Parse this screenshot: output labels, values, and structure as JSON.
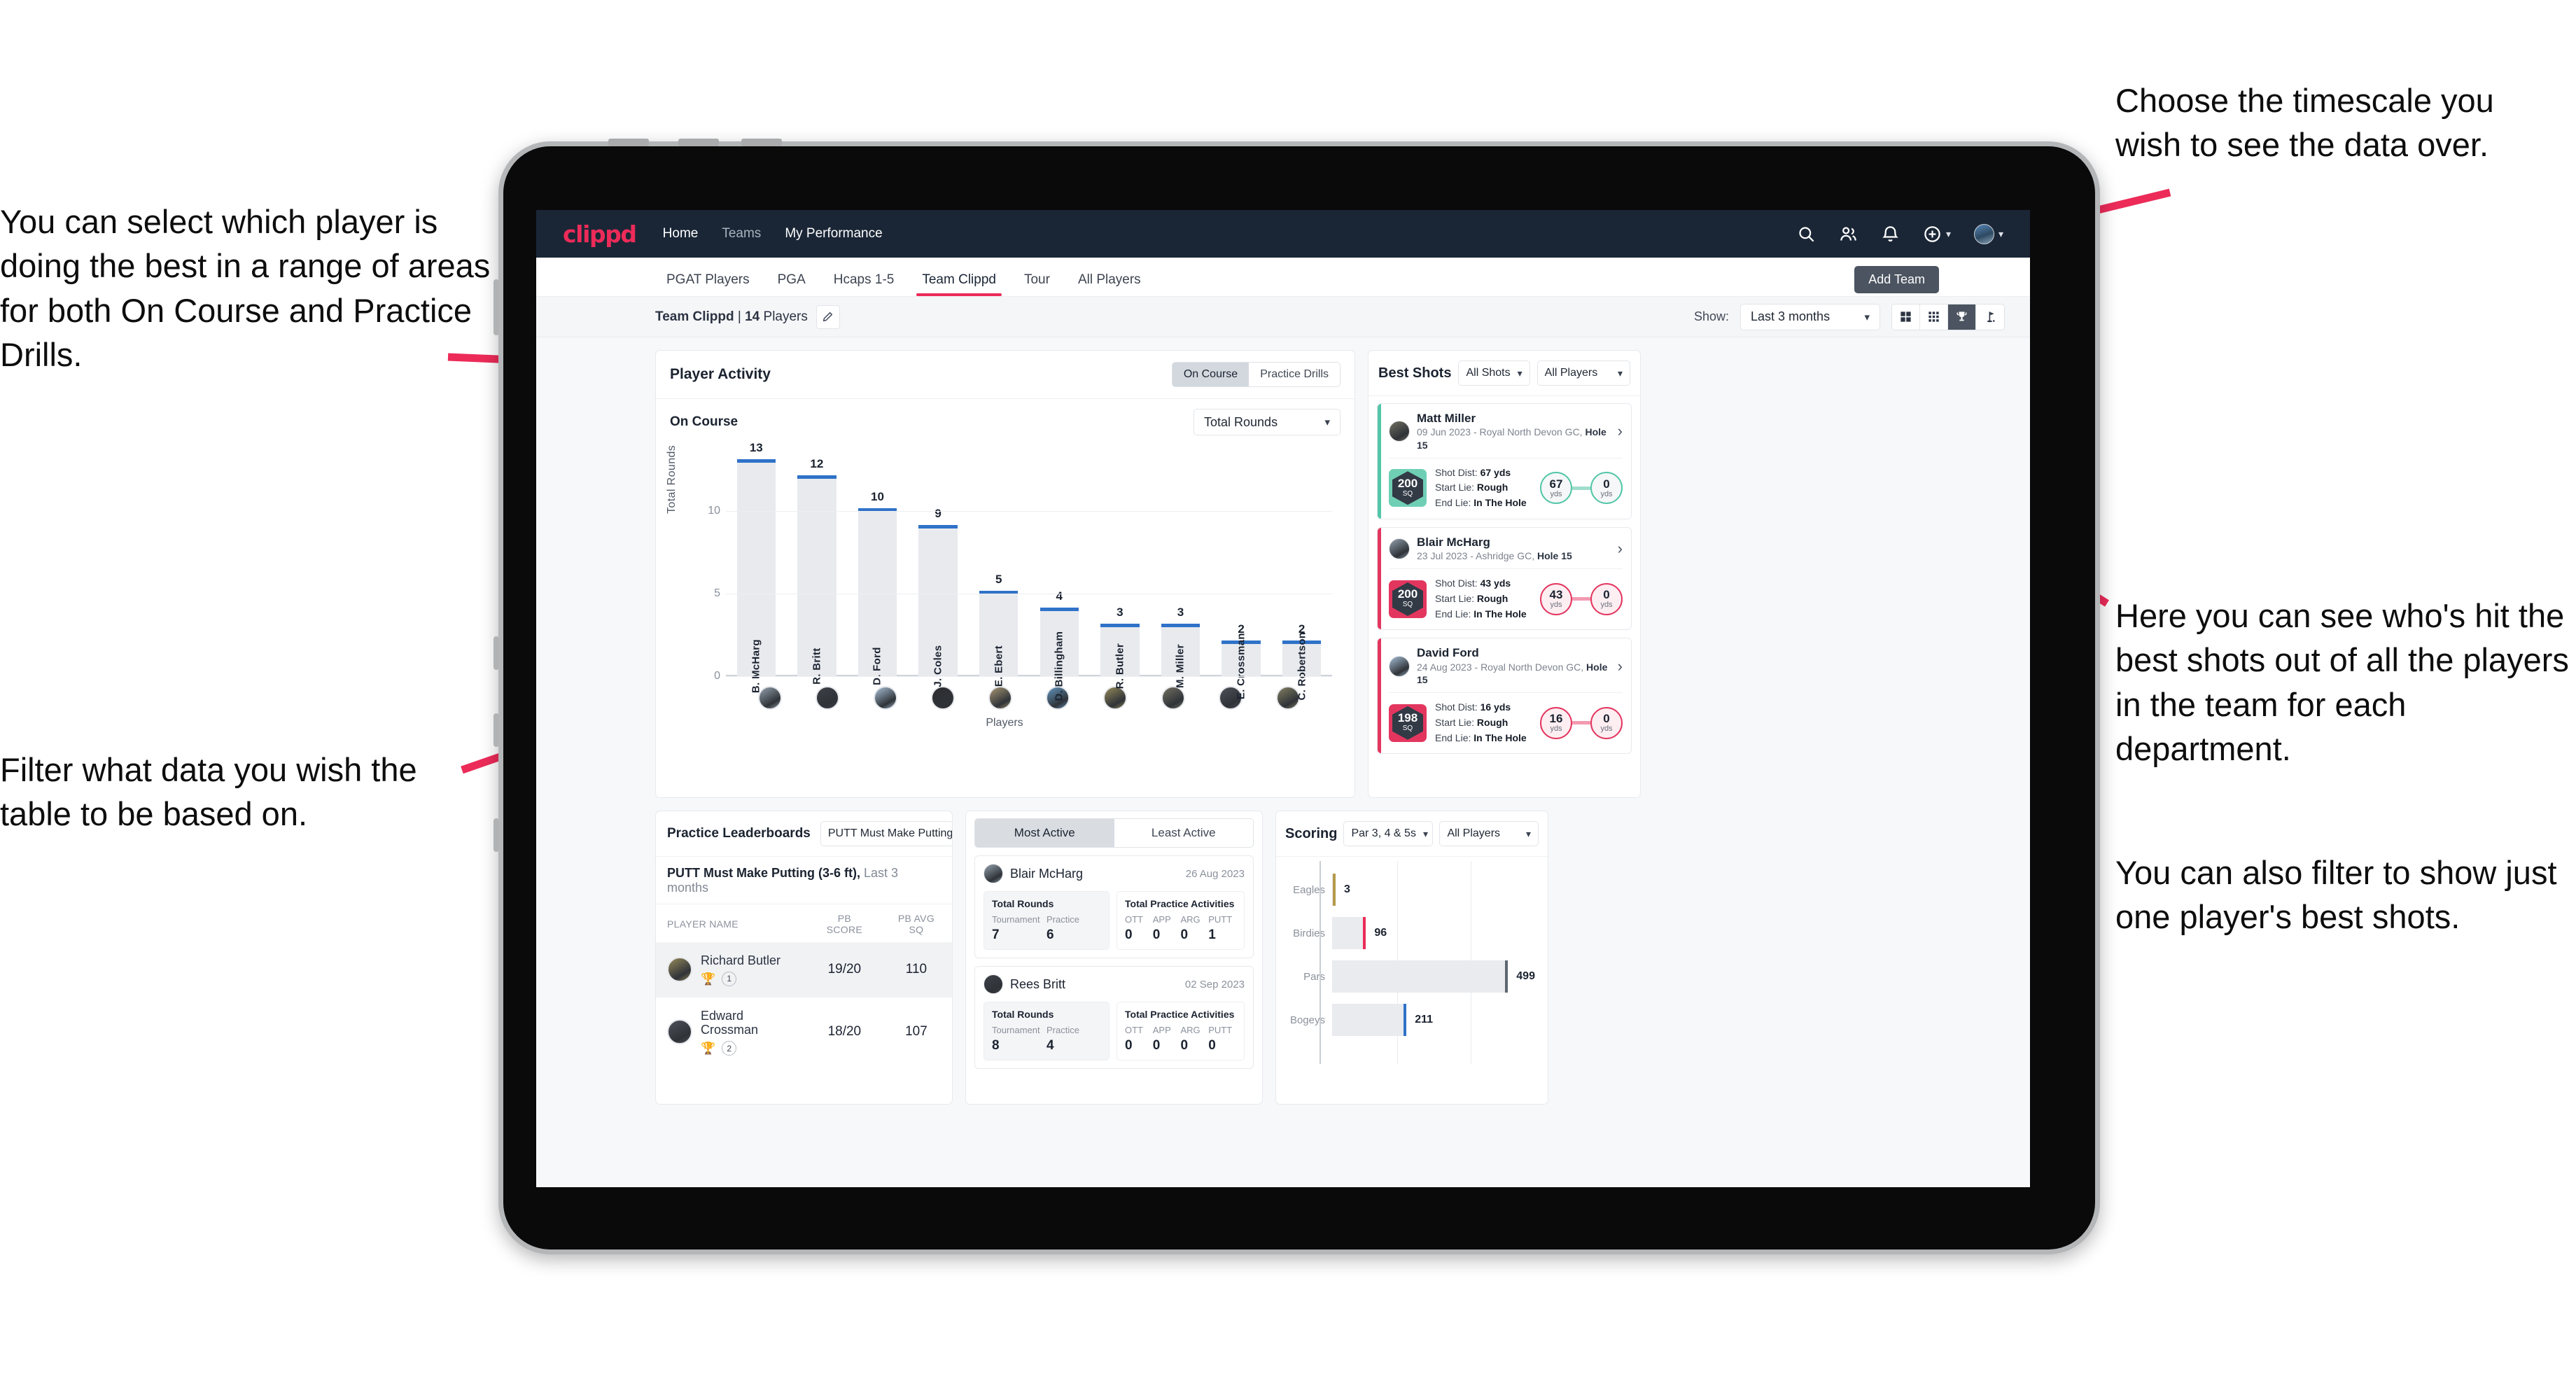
{
  "annotations": {
    "left_top": "You can select which player is doing the best in a range of areas for both On Course and Practice Drills.",
    "left_bottom": "Filter what data you wish the table to be based on.",
    "right_top": "Choose the timescale you wish to see the data over.",
    "right_middle": "Here you can see who's hit the best shots out of all the players in the team for each department.",
    "right_bottom": "You can also filter to show just one player's best shots."
  },
  "app": {
    "brand": "clippd",
    "nav": [
      {
        "label": "Home",
        "active": true
      },
      {
        "label": "Teams",
        "active": false
      },
      {
        "label": "My Performance",
        "active": true
      }
    ],
    "icons": {
      "search": "search-icon",
      "people": "people-icon",
      "bell": "bell-icon",
      "plus": "plus-circle-icon",
      "avatar": "user-avatar"
    },
    "tabs": [
      {
        "label": "PGAT Players",
        "active": false
      },
      {
        "label": "PGA",
        "active": false
      },
      {
        "label": "Hcaps 1-5",
        "active": false
      },
      {
        "label": "Team Clippd",
        "active": true
      },
      {
        "label": "Tour",
        "active": false
      },
      {
        "label": "All Players",
        "active": false
      }
    ],
    "add_team_tooltip": "Add Team",
    "subbar": {
      "team_name": "Team Clippd",
      "team_separator": " | ",
      "player_count": "14",
      "players_word": " Players",
      "edit_icon": "pencil-icon",
      "show_label": "Show:",
      "period_value": "Last 3 months",
      "view_buttons": [
        {
          "name": "grid-large-icon",
          "active": false
        },
        {
          "name": "grid-small-icon",
          "active": false
        },
        {
          "name": "trophy-icon",
          "active": true
        },
        {
          "name": "golf-flag-icon",
          "active": false
        }
      ]
    },
    "accent_color": "#ec2b59",
    "navbar_color": "#1a2636"
  },
  "player_activity": {
    "title": "Player Activity",
    "segments": [
      {
        "label": "On Course",
        "active": true
      },
      {
        "label": "Practice Drills",
        "active": false
      }
    ],
    "sub_label": "On Course",
    "metric_select": "Total Rounds"
  },
  "chart_data": [
    {
      "type": "bar",
      "title": "Player Activity - On Course",
      "xlabel": "Players",
      "ylabel": "Total Rounds",
      "ylim": [
        0,
        14
      ],
      "yticks": [
        0,
        5,
        10
      ],
      "grid": true,
      "categories": [
        "B. McHarg",
        "R. Britt",
        "D. Ford",
        "J. Coles",
        "E. Ebert",
        "D. Billingham",
        "R. Butler",
        "M. Miller",
        "E. Crossman",
        "C. Robertson"
      ],
      "values": [
        13,
        12,
        10,
        9,
        5,
        4,
        3,
        3,
        2,
        2
      ],
      "bar_color": "#e8eaee",
      "cap_color": "#2f72c8",
      "avatar_colors": [
        "#8d9aa6",
        "#3c3f45",
        "#9fb6cc",
        "#2c2c2e",
        "#a09070",
        "#5e8fb6",
        "#8e8357",
        "#6e6c5f",
        "#4b4f56",
        "#7d7a5e"
      ]
    },
    {
      "type": "bar",
      "orientation": "horizontal",
      "title": "Scoring",
      "categories": [
        "Eagles",
        "Birdies",
        "Pars",
        "Bogeys"
      ],
      "values": [
        3,
        96,
        499,
        211
      ],
      "xlim": [
        0,
        560
      ],
      "tip_colors": [
        "#b59a4a",
        "#ec2b59",
        "#5e6672",
        "#2f72c8"
      ],
      "bar_color": "#e9ebee",
      "grid": true
    }
  ],
  "best_shots": {
    "title": "Best Shots",
    "shot_filter": "All Shots",
    "player_filter": "All Players",
    "labels": {
      "shot_dist": "Shot Dist:",
      "start_lie": "Start Lie:",
      "end_lie": "End Lie:",
      "yds": "yds",
      "sq": "SQ"
    },
    "items": [
      {
        "player": "Matt Miller",
        "meta_date": "09 Jun 2023 - Royal North Devon GC, ",
        "meta_hole": "Hole 15",
        "sq_value": "200",
        "shot_dist": "67 yds",
        "start_lie": "Rough",
        "end_lie": "In The Hole",
        "start_value": "67",
        "end_value": "0",
        "accent": "teal",
        "avatar_color": "#6e6c5f"
      },
      {
        "player": "Blair McHarg",
        "meta_date": "23 Jul 2023 - Ashridge GC, ",
        "meta_hole": "Hole 15",
        "sq_value": "200",
        "shot_dist": "43 yds",
        "start_lie": "Rough",
        "end_lie": "In The Hole",
        "start_value": "43",
        "end_value": "0",
        "accent": "pink",
        "avatar_color": "#8d9aa6"
      },
      {
        "player": "David Ford",
        "meta_date": "24 Aug 2023 - Royal North Devon GC, ",
        "meta_hole": "Hole 15",
        "sq_value": "198",
        "shot_dist": "16 yds",
        "start_lie": "Rough",
        "end_lie": "In The Hole",
        "start_value": "16",
        "end_value": "0",
        "accent": "pink",
        "avatar_color": "#9fb6cc"
      }
    ]
  },
  "practice_leaderboards": {
    "title": "Practice Leaderboards",
    "drill_select": "PUTT Must Make Putting ...",
    "subtitle_bold": "PUTT Must Make Putting (3-6 ft),",
    "subtitle_rest": " Last 3 months",
    "columns": [
      "PLAYER NAME",
      "PB SCORE",
      "PB AVG SQ"
    ],
    "rows": [
      {
        "name": "Richard Butler",
        "rank": "1",
        "trophy": "gold",
        "pb_score": "19/20",
        "pb_avg_sq": "110",
        "highlight": true,
        "avatar_color": "#8e8357"
      },
      {
        "name": "Edward Crossman",
        "rank": "2",
        "trophy": "silver",
        "pb_score": "18/20",
        "pb_avg_sq": "107",
        "highlight": false,
        "avatar_color": "#4b4f56"
      }
    ]
  },
  "activity": {
    "tabs": [
      {
        "label": "Most Active",
        "active": true
      },
      {
        "label": "Least Active",
        "active": false
      }
    ],
    "rounds_title": "Total Rounds",
    "practice_title": "Total Practice Activities",
    "rounds_cols": [
      "Tournament",
      "Practice"
    ],
    "practice_cols": [
      "OTT",
      "APP",
      "ARG",
      "PUTT"
    ],
    "cards": [
      {
        "player": "Blair McHarg",
        "date": "26 Aug 2023",
        "rounds": [
          "7",
          "6"
        ],
        "practice": [
          "0",
          "0",
          "0",
          "1"
        ],
        "avatar_color": "#8d9aa6"
      },
      {
        "player": "Rees Britt",
        "date": "02 Sep 2023",
        "rounds": [
          "8",
          "4"
        ],
        "practice": [
          "0",
          "0",
          "0",
          "0"
        ],
        "avatar_color": "#3c3f45"
      }
    ]
  },
  "scoring": {
    "title": "Scoring",
    "par_select": "Par 3, 4 & 5s",
    "player_select": "All Players"
  }
}
